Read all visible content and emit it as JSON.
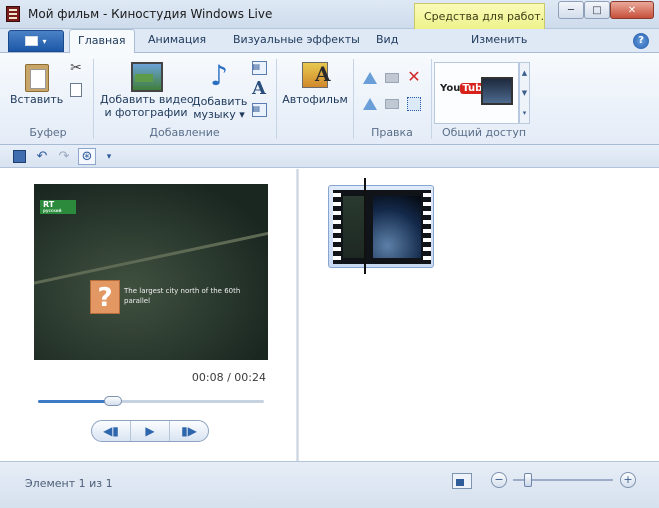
{
  "window": {
    "title": "Мой фильм - Киностудия Windows Live",
    "context_tab": "Средства для работ...",
    "controls": {
      "minimize": "─",
      "maximize": "□",
      "close": "✕"
    }
  },
  "ribbon": {
    "app_menu_arrow": "▾",
    "tabs": [
      {
        "label": "Главная",
        "active": true
      },
      {
        "label": "Анимация"
      },
      {
        "label": "Визуальные эффекты"
      },
      {
        "label": "Вид"
      },
      {
        "label": "Изменить"
      }
    ],
    "help": "?",
    "groups": {
      "clipboard": {
        "label": "Буфер",
        "paste": "Вставить"
      },
      "add": {
        "label": "Добавление",
        "add_video_line1": "Добавить видео",
        "add_video_line2": "и фотографии",
        "add_music_line1": "Добавить",
        "add_music_line2": "музыку",
        "title_text": "A"
      },
      "automovie": {
        "label": "Автофильм"
      },
      "edit": {
        "label": "Правка"
      },
      "share": {
        "label": "Общий доступ",
        "youtube_you": "You",
        "youtube_tube": "Tube"
      }
    }
  },
  "qat": {
    "undo": "↶",
    "redo": "↷",
    "dropdown": "▾"
  },
  "preview": {
    "channel_logo": "RT",
    "channel_sub": "русский",
    "question_mark": "?",
    "caption": "The largest city north of the 60th parallel",
    "time": "00:08 / 00:24",
    "progress": 0.333,
    "transport": {
      "prev": "◀▮",
      "play": "▶",
      "next": "▮▶"
    }
  },
  "status": {
    "text": "Элемент 1 из 1",
    "zoom_out": "−",
    "zoom_in": "+",
    "zoom_level": 0.15
  },
  "colors": {
    "accent": "#3d7bc7",
    "context_tab": "#eef28a",
    "close_button": "#c6503a"
  }
}
